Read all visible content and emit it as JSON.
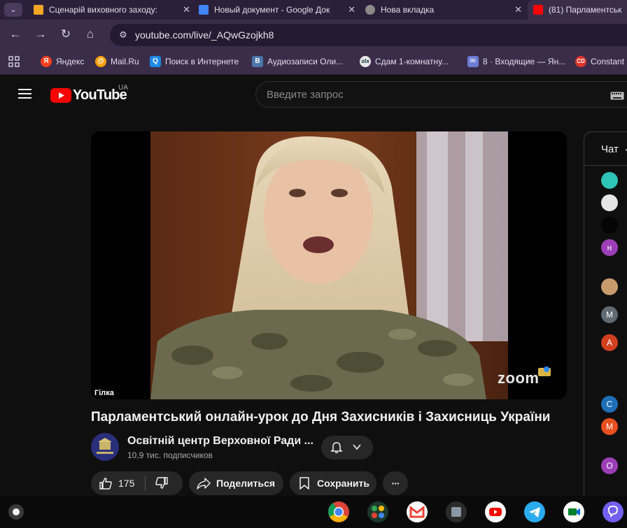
{
  "tabs": [
    {
      "title": "Сценарій виховного заходу: "
    },
    {
      "title": "Новый документ - Google Док"
    },
    {
      "title": "Нова вкладка"
    },
    {
      "title": "(81) Парламентськ"
    }
  ],
  "address": {
    "url": "youtube.com/live/_AQwGzojkh8"
  },
  "bookmarks": [
    {
      "label": "Яндекс"
    },
    {
      "label": "Mail.Ru"
    },
    {
      "label": "Поиск в Интернете"
    },
    {
      "label": "Аудиозаписи Оли..."
    },
    {
      "label": "Сдам 1-комнатну..."
    },
    {
      "label": "8 · Входящие — Ян..."
    },
    {
      "label": "Constant"
    }
  ],
  "youtube": {
    "logo_text": "YouTube",
    "region": "UA",
    "search_placeholder": "Введите запрос"
  },
  "video": {
    "overlay_name": "Гілка",
    "watermark": "zoom",
    "title": "Парламентський онлайн-урок до Дня Захисників і Захисниць України"
  },
  "channel": {
    "name": "Освітній центр Верховної Ради ...",
    "subscribers": "10,9 тис. подписчиков"
  },
  "actions": {
    "likes": "175",
    "share": "Поделиться",
    "save": "Сохранить",
    "more": "···"
  },
  "chat": {
    "label": "Чат",
    "avatars": [
      "",
      "",
      "",
      "н",
      "",
      "М",
      "А",
      "С",
      "М",
      "О"
    ]
  },
  "colors": {
    "youtube_red": "#ff0000",
    "browser_frame": "#3b2d4a",
    "page_bg": "#0f0f0f"
  }
}
